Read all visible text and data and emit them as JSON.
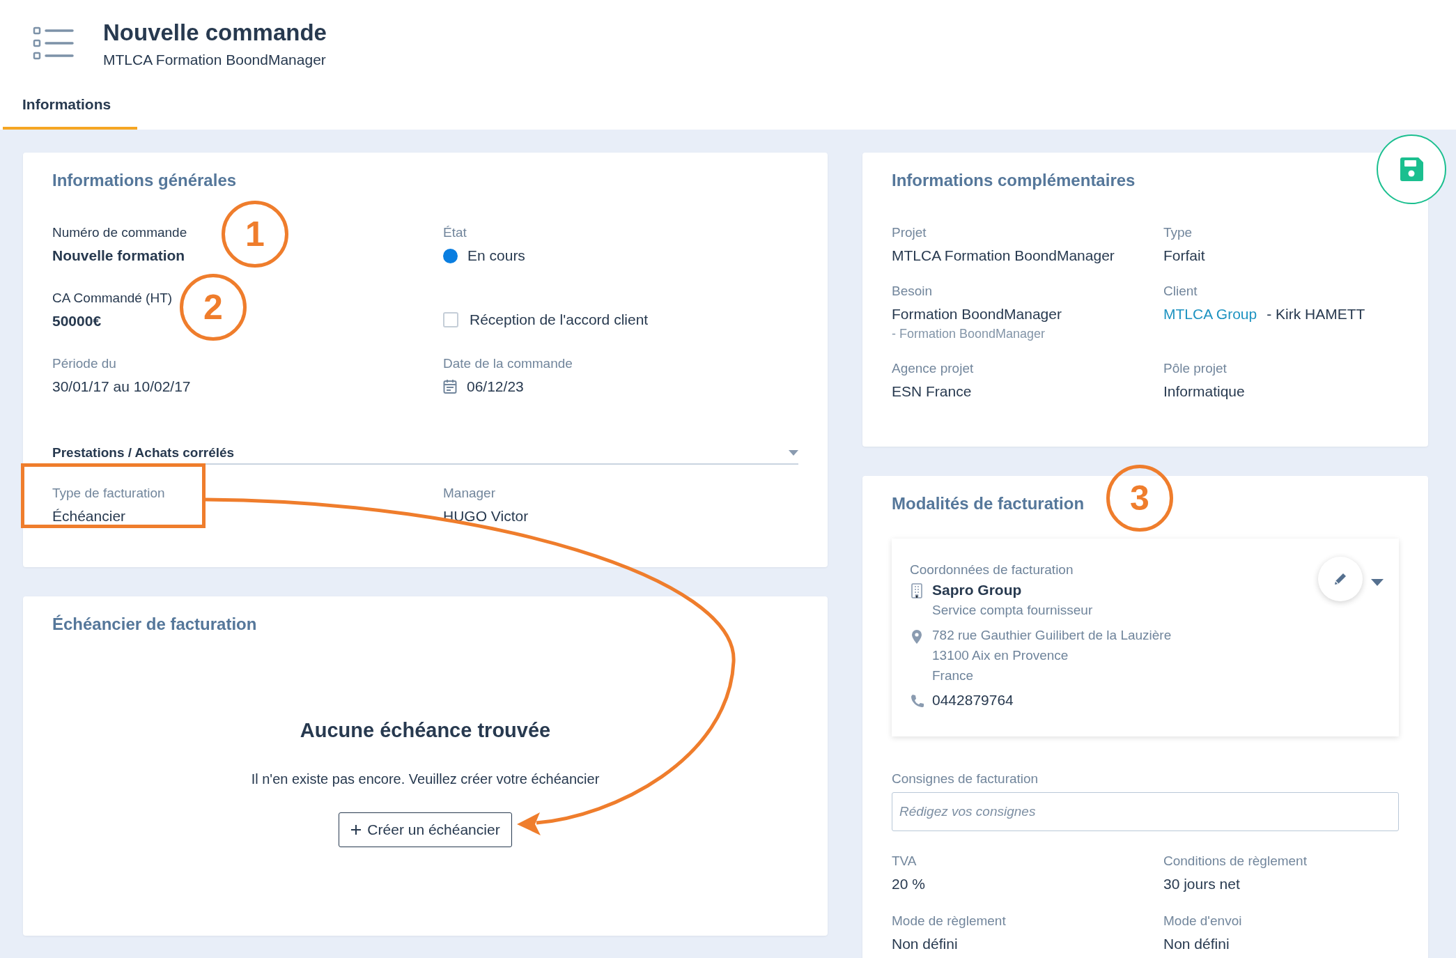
{
  "header": {
    "title": "Nouvelle commande",
    "subtitle": "MTLCA Formation BoondManager"
  },
  "tabs": [
    {
      "label": "Informations",
      "selected": true
    }
  ],
  "general": {
    "title": "Informations générales",
    "fields": [
      {
        "label": "Numéro de commande",
        "value": "Nouvelle formation",
        "kind": "bold"
      },
      {
        "label": "État",
        "value": "En cours",
        "kind": "status"
      },
      {
        "label": "CA Commandé (HT)",
        "value": "50000€",
        "kind": "bold"
      },
      {
        "label": "Réception de l'accord client",
        "kind": "checkbox",
        "checked": false
      },
      {
        "label": "Période du",
        "value": "30/01/17 au 10/02/17",
        "kind": "text"
      },
      {
        "label": "Date de la commande",
        "value": "06/12/23",
        "kind": "date"
      }
    ],
    "section": {
      "label": "Prestations / Achats corrélés"
    },
    "fields_after": [
      {
        "label": "Type de facturation",
        "value": "Échéancier",
        "kind": "text"
      },
      {
        "label": "Manager",
        "value": "HUGO Victor",
        "kind": "text"
      }
    ]
  },
  "schedule": {
    "title": "Échéancier de facturation",
    "empty_title": "Aucune échéance trouvée",
    "empty_text": "Il n'en existe pas encore. Veuillez créer votre échéancier",
    "button": "Créer un échéancier"
  },
  "complementary": {
    "title": "Informations complémentaires",
    "fields": [
      {
        "label": "Projet",
        "value": "MTLCA Formation BoondManager"
      },
      {
        "label": "Type",
        "value": "Forfait"
      },
      {
        "label": "Besoin",
        "value": "Formation BoondManager",
        "sub": "- Formation BoondManager"
      },
      {
        "label": "Client",
        "link": "MTLCA Group",
        "value": "- Kirk HAMETT"
      },
      {
        "label": "Agence projet",
        "value": "ESN France"
      },
      {
        "label": "Pôle projet",
        "value": "Informatique"
      }
    ]
  },
  "billing": {
    "title": "Modalités de facturation",
    "address": {
      "label": "Coordonnées de facturation",
      "company": "Sapro Group",
      "department": "Service compta fournisseur",
      "lines": [
        "782 rue Gauthier Guilibert de la Lauzière",
        "13100 Aix en Provence",
        "France"
      ],
      "phone": "0442879764"
    },
    "instructions": {
      "label": "Consignes de facturation",
      "placeholder": "Rédigez vos consignes"
    },
    "fields": [
      {
        "label": "TVA",
        "value": "20 %"
      },
      {
        "label": "Conditions de règlement",
        "value": "30 jours net"
      },
      {
        "label": "Mode de règlement",
        "value": "Non défini"
      },
      {
        "label": "Mode d'envoi",
        "value": "Non défini"
      }
    ]
  },
  "annotations": {
    "steps": [
      "1",
      "2",
      "3"
    ]
  }
}
